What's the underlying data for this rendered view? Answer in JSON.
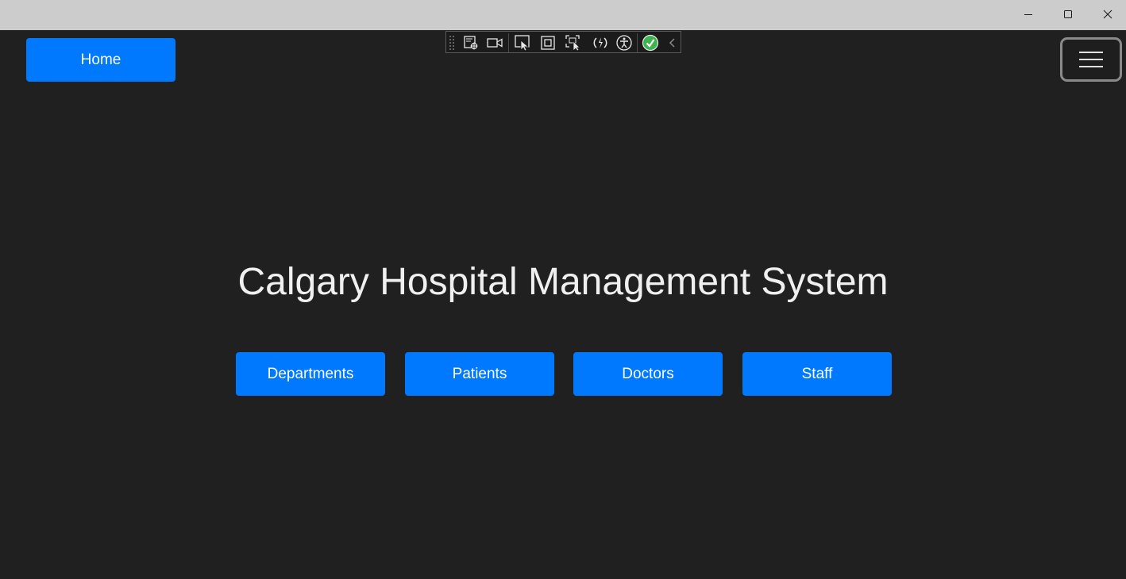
{
  "window": {
    "controls": [
      "minimize-icon",
      "maximize-icon",
      "close-icon"
    ]
  },
  "header": {
    "home_label": "Home",
    "menu_icon": "hamburger-menu-icon"
  },
  "devtools_toolbar": {
    "icons": [
      "live-visual-tree-icon",
      "video-camera-icon",
      "select-element-icon",
      "display-layout-adorners-icon",
      "track-focus-icon",
      "hot-reload-icon",
      "accessibility-icon",
      "binding-check-icon",
      "collapse-chevron-icon"
    ],
    "status_color": "#3fb34f"
  },
  "main": {
    "title": "Calgary Hospital Management System",
    "buttons": [
      {
        "label": "Departments"
      },
      {
        "label": "Patients"
      },
      {
        "label": "Doctors"
      },
      {
        "label": "Staff"
      }
    ]
  },
  "colors": {
    "accent": "#0079ff",
    "background": "#202020",
    "titlebar": "#cccccc",
    "text": "#f0f0f0"
  }
}
